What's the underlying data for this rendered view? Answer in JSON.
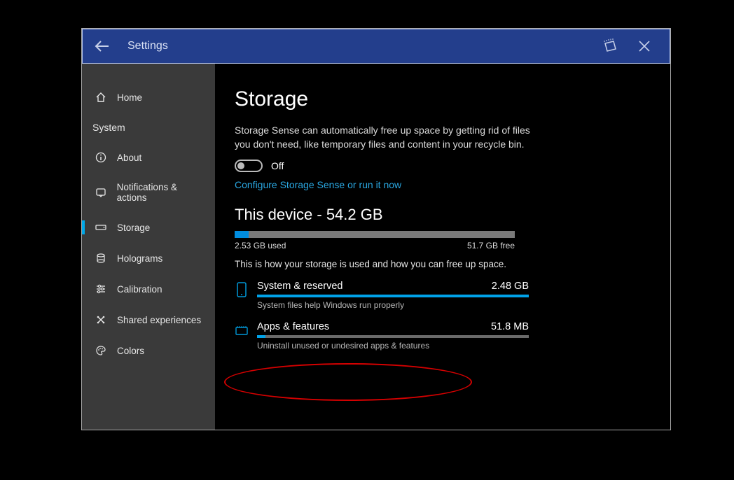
{
  "titlebar": {
    "title": "Settings"
  },
  "sidebar": {
    "items": [
      {
        "id": "home",
        "label": "Home"
      },
      {
        "id": "system",
        "label": "System"
      },
      {
        "id": "about",
        "label": "About"
      },
      {
        "id": "notifications",
        "label": "Notifications & actions"
      },
      {
        "id": "storage",
        "label": "Storage"
      },
      {
        "id": "holograms",
        "label": "Holograms"
      },
      {
        "id": "calibration",
        "label": "Calibration"
      },
      {
        "id": "shared",
        "label": "Shared experiences"
      },
      {
        "id": "colors",
        "label": "Colors"
      }
    ]
  },
  "main": {
    "title": "Storage",
    "description": "Storage Sense can automatically free up space by getting rid of files you don't need, like temporary files and content in your recycle bin.",
    "toggle_label": "Off",
    "configure_link": "Configure Storage Sense or run it now",
    "device_heading": "This device - 54.2 GB",
    "device_used": "2.53 GB used",
    "device_free": "51.7 GB free",
    "device_used_pct": 5,
    "storage_hint": "This is how your storage is used and how you can free up space.",
    "categories": [
      {
        "id": "system",
        "title": "System & reserved",
        "size": "2.48 GB",
        "sub": "System files help Windows run properly",
        "pct": 100
      },
      {
        "id": "apps",
        "title": "Apps & features",
        "size": "51.8 MB",
        "sub": "Uninstall unused or undesired apps & features",
        "pct": 3
      }
    ]
  }
}
